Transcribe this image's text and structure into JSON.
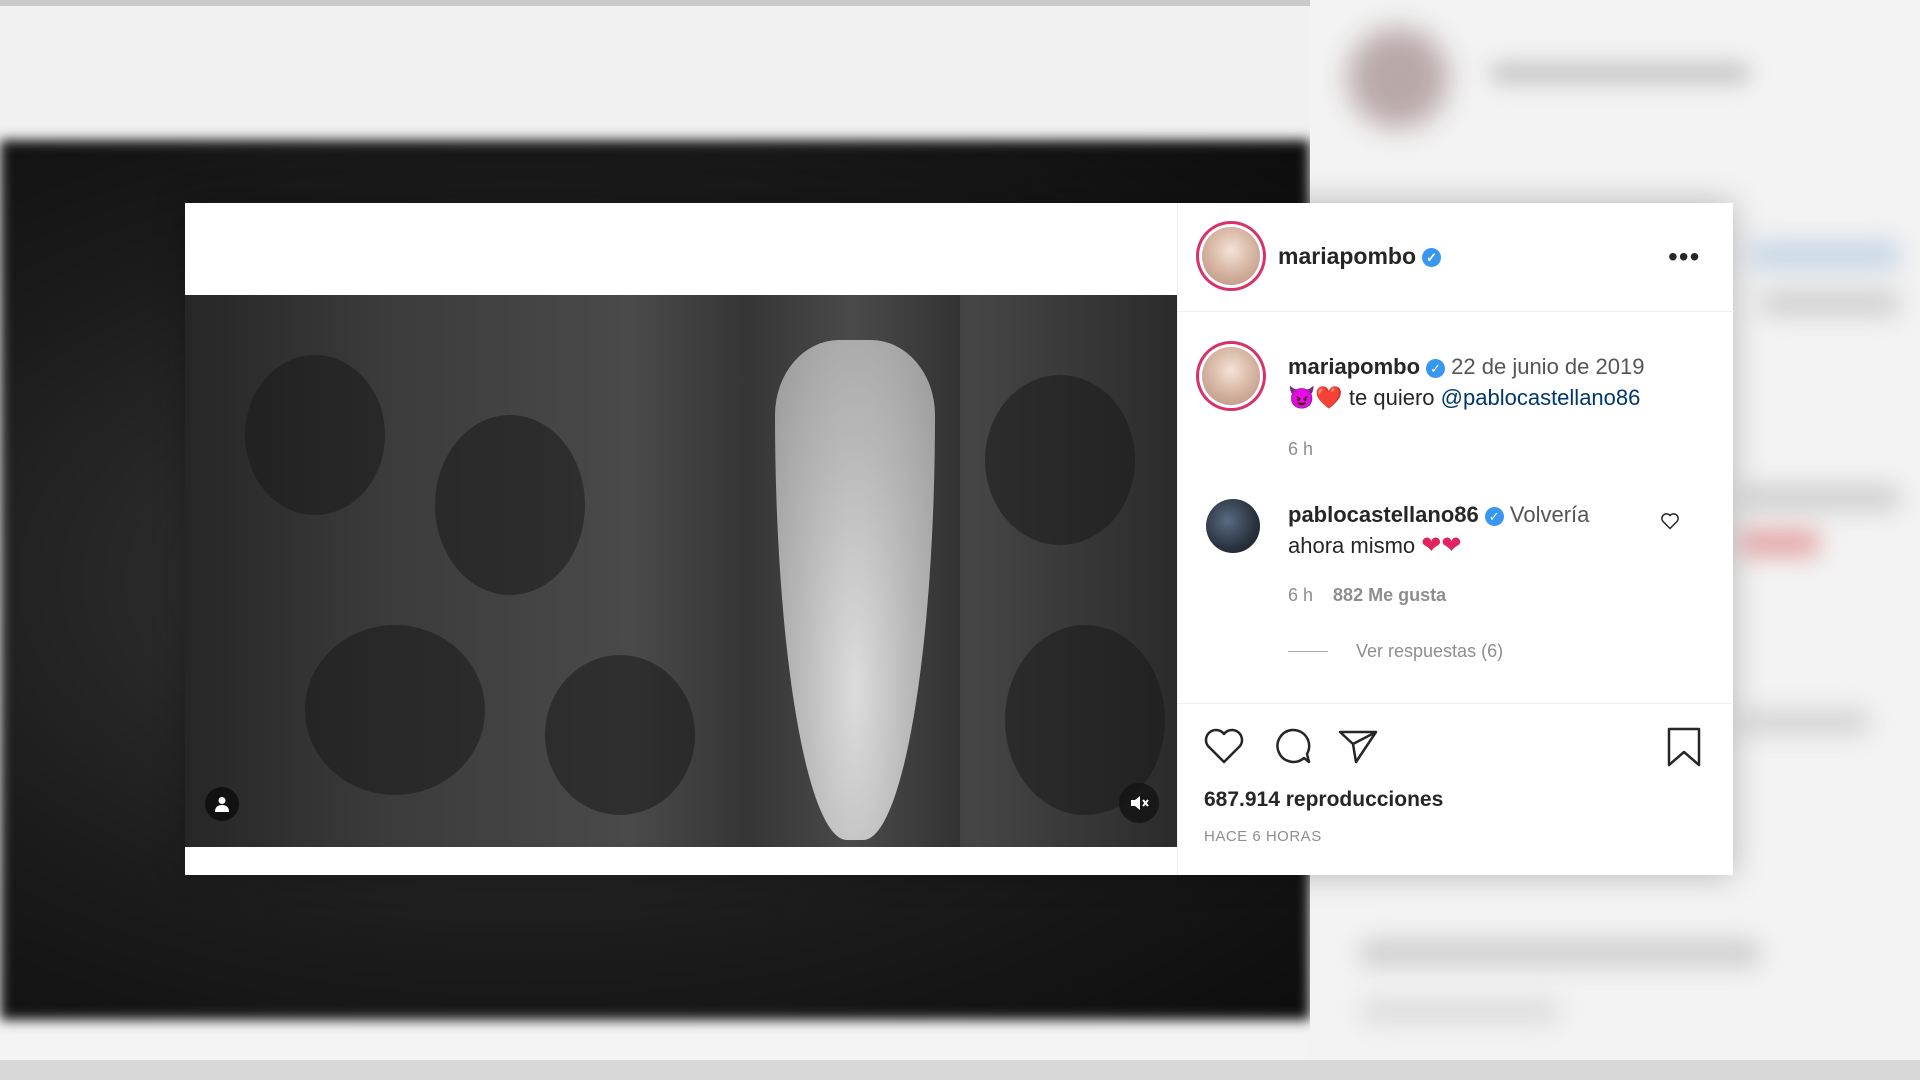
{
  "post": {
    "author": "mariapombo",
    "caption": {
      "author": "mariapombo",
      "date": "22 de junio de 2019",
      "text": "te quiero",
      "mention": "@pablocastellano86",
      "emojis": "😈❤️",
      "time": "6 h"
    },
    "comment": {
      "author": "pablocastellano86",
      "text_line1": "Volvería",
      "text_line2": "ahora mismo",
      "emojis": "❤❤",
      "time": "6 h",
      "likes": "882 Me gusta",
      "view_replies": "Ver respuestas (6)"
    },
    "views": "687.914 reproducciones",
    "posted": "HACE 6 HORAS"
  },
  "colors": {
    "verified": "#3897f0",
    "mention": "#00376b",
    "heart": "#e0245e",
    "story_ring": "#d6336c"
  },
  "icons": {
    "verified": "verified-badge-icon",
    "more": "more-options-icon",
    "like": "heart-icon",
    "comment": "comment-icon",
    "share": "share-icon",
    "save": "bookmark-icon",
    "tag": "user-tag-icon",
    "mute": "muted-speaker-icon"
  }
}
